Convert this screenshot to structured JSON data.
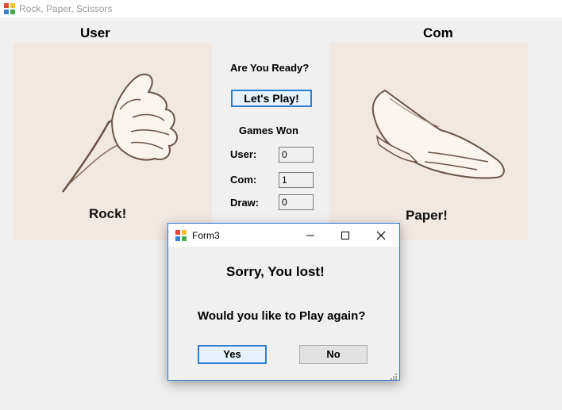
{
  "window": {
    "title": "Rock, Paper, Scissors"
  },
  "user": {
    "heading": "User",
    "choice": "Rock!"
  },
  "com": {
    "heading": "Com",
    "choice": "Paper!"
  },
  "center": {
    "ready": "Are You Ready?",
    "play_button": "Let's Play!",
    "games_won": "Games Won",
    "user_label": "User:",
    "com_label": "Com:",
    "draw_label": "Draw:",
    "user_score": "0",
    "com_score": "1",
    "draw_score": "0"
  },
  "dialog": {
    "title": "Form3",
    "message": "Sorry, You lost!",
    "question": "Would you like to Play again?",
    "yes": "Yes",
    "no": "No"
  },
  "icons": [
    "app-icon",
    "minimize-icon",
    "maximize-icon",
    "close-icon",
    "fist-icon",
    "open-hand-icon",
    "resize-grip-icon"
  ],
  "colors": {
    "panel_bg": "#f2e8e2",
    "focus_blue": "#2f7fd0",
    "window_bg": "#f0f0f0"
  }
}
